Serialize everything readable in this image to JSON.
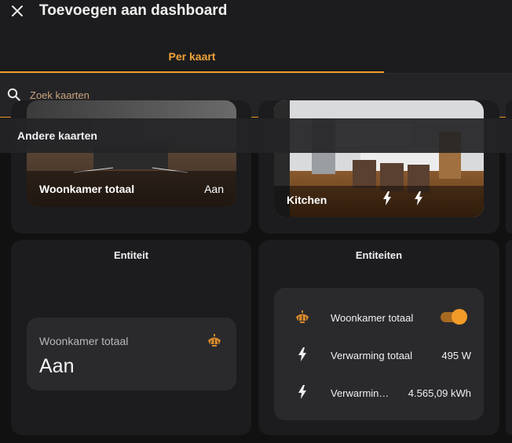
{
  "header": {
    "title": "Toevoegen aan dashboard",
    "tab_label": "Per kaart"
  },
  "search": {
    "placeholder": "Zoek kaarten"
  },
  "section": {
    "title": "Andere kaarten"
  },
  "cards": {
    "picture_living": {
      "name": "Woonkamer totaal",
      "state": "Aan"
    },
    "picture_kitchen": {
      "name": "Kitchen"
    },
    "entity": {
      "title": "Entiteit",
      "name": "Woonkamer totaal",
      "state": "Aan",
      "icon": "ceiling-light-icon"
    },
    "entities": {
      "title": "Entiteiten",
      "rows": [
        {
          "icon": "ceiling-light-icon",
          "name": "Woonkamer totaal",
          "toggle_on": true
        },
        {
          "icon": "flash-icon",
          "name": "Verwarming totaal",
          "value": "495 W"
        },
        {
          "icon": "flash-icon",
          "name": "Verwarmin…",
          "value": "4.565,09 kWh"
        }
      ]
    }
  },
  "colors": {
    "accent": "#f29b28",
    "background": "#111111",
    "card": "#1c1c1e",
    "light_icon": "#d98a2b"
  }
}
